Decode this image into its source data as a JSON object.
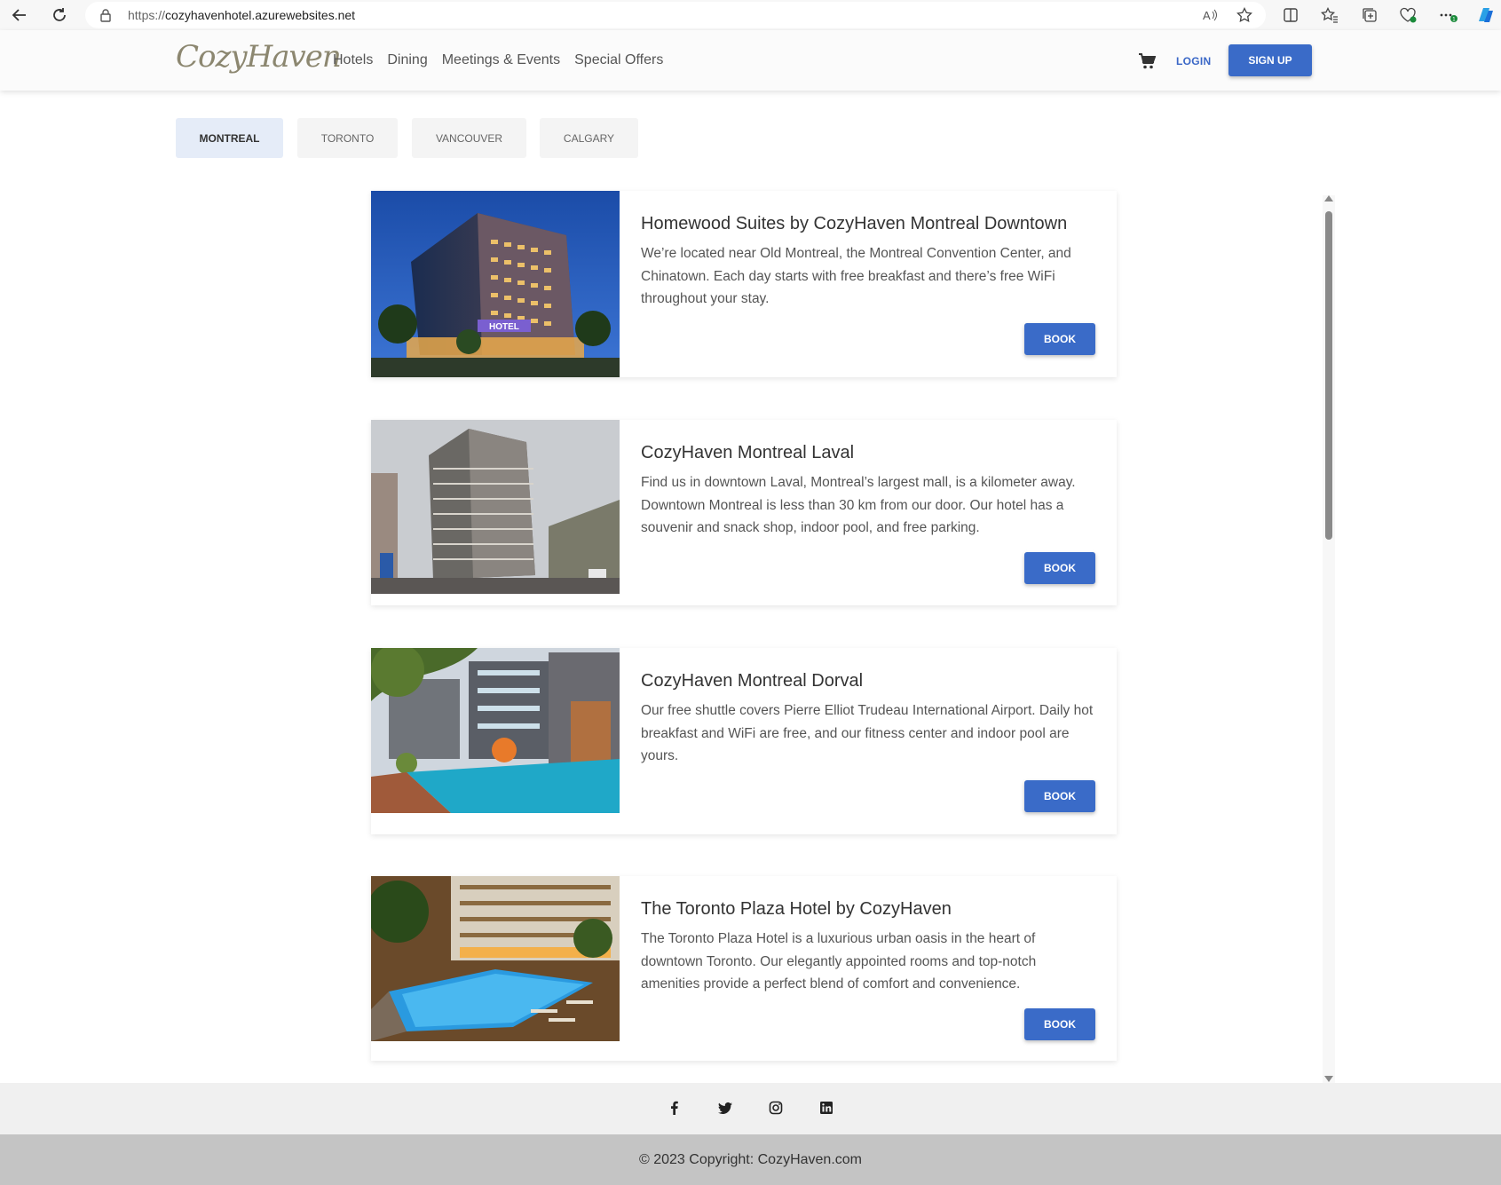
{
  "browser": {
    "url_protocol": "https://",
    "url_host": "cozyhavenhotel.azurewebsites.net",
    "icons": [
      "back-arrow-icon",
      "refresh-icon",
      "lock-icon",
      "read-aloud-icon",
      "favorite-star-icon",
      "split-screen-icon",
      "favorites-icon",
      "collections-icon",
      "health-icon",
      "more-icon",
      "copilot-icon"
    ]
  },
  "header": {
    "logo_text": "CozyHaven",
    "nav": [
      "Hotels",
      "Dining",
      "Meetings & Events",
      "Special Offers"
    ],
    "login_label": "LOGIN",
    "signup_label": "SIGN UP",
    "accent_color": "#3a6bc8"
  },
  "tabs": [
    {
      "label": "MONTREAL",
      "active": true
    },
    {
      "label": "TORONTO",
      "active": false
    },
    {
      "label": "VANCOUVER",
      "active": false
    },
    {
      "label": "CALGARY",
      "active": false
    }
  ],
  "hotels": [
    {
      "name": "Homewood Suites by CozyHaven Montreal Downtown",
      "description": "We’re located near Old Montreal, the Montreal Convention Center, and Chinatown. Each day starts with free breakfast and there’s free WiFi throughout your stay.",
      "book_label": "BOOK",
      "image_sign": "HOTEL"
    },
    {
      "name": "CozyHaven Montreal Laval",
      "description": "Find us in downtown Laval, Montreal’s largest mall, is a kilometer away. Downtown Montreal is less than 30 km from our door. Our hotel has a souvenir and snack shop, indoor pool, and free parking.",
      "book_label": "BOOK"
    },
    {
      "name": "CozyHaven Montreal Dorval",
      "description": "Our free shuttle covers Pierre Elliot Trudeau International Airport. Daily hot breakfast and WiFi are free, and our fitness center and indoor pool are yours.",
      "book_label": "BOOK"
    },
    {
      "name": "The Toronto Plaza Hotel by CozyHaven",
      "description": "The Toronto Plaza Hotel is a luxurious urban oasis in the heart of downtown Toronto. Our elegantly appointed rooms and top-notch amenities provide a perfect blend of comfort and convenience.",
      "book_label": "BOOK"
    }
  ],
  "footer": {
    "social": [
      "facebook-icon",
      "twitter-icon",
      "instagram-icon",
      "linkedin-icon"
    ],
    "copyright": "© 2023 Copyright: CozyHaven.com"
  }
}
